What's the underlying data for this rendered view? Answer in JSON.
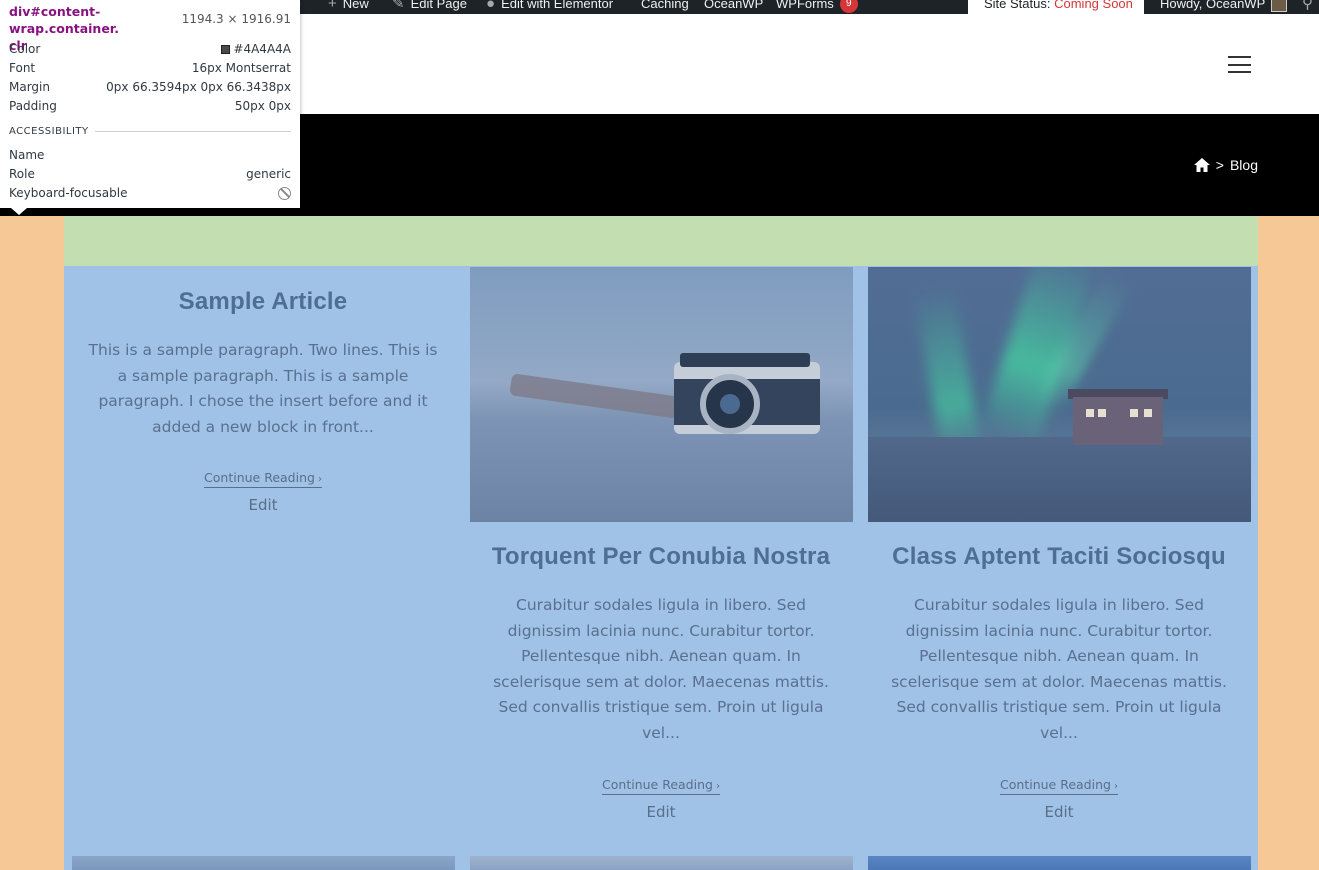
{
  "adminbar": {
    "items": [
      {
        "label": "New",
        "icon": "plus-icon"
      },
      {
        "label": "Edit Page",
        "icon": "pencil-icon"
      },
      {
        "label": "Edit with Elementor",
        "icon": "elementor-icon"
      },
      {
        "label": "Caching"
      },
      {
        "label": "OceanWP"
      },
      {
        "label": "WPForms",
        "badge": "9"
      }
    ],
    "site_status_label": "Site Status:",
    "site_status_value": "Coming Soon",
    "howdy": "Howdy, OceanWP"
  },
  "breadcrumb": {
    "separator": ">",
    "current": "Blog"
  },
  "tooltip": {
    "selector": "div#content-wrap.container.",
    "selector_cont": "clr",
    "dimensions": "1194.3 × 1916.91",
    "color_label": "Color",
    "color_value": "#4A4A4A",
    "font_label": "Font",
    "font_value": "16px Montserrat",
    "margin_label": "Margin",
    "margin_value": "0px 66.3594px 0px 66.3438px",
    "padding_label": "Padding",
    "padding_value": "50px 0px",
    "section": "ACCESSIBILITY",
    "name_label": "Name",
    "name_value": "",
    "role_label": "Role",
    "role_value": "generic",
    "focus_label": "Keyboard-focusable"
  },
  "articles": [
    {
      "title": "Sample Article",
      "excerpt": "This is a sample paragraph. Two lines. This is a sample paragraph. This is a sample paragraph. I chose the insert before and it added a new block in front...",
      "read_more": "Continue Reading",
      "edit": "Edit"
    },
    {
      "title": "Torquent Per Conubia Nostra",
      "excerpt": "Curabitur sodales ligula in libero. Sed dignissim lacinia nunc. Curabitur tortor. Pellentesque nibh. Aenean quam. In scelerisque sem at dolor. Maecenas mattis. Sed convallis tristique sem. Proin ut ligula vel...",
      "read_more": "Continue Reading",
      "edit": "Edit"
    },
    {
      "title": "Class Aptent Taciti Sociosqu",
      "excerpt": "Curabitur sodales ligula in libero. Sed dignissim lacinia nunc. Curabitur tortor. Pellentesque nibh. Aenean quam. In scelerisque sem at dolor. Maecenas mattis. Sed convallis tristique sem. Proin ut ligula vel...",
      "read_more": "Continue Reading",
      "edit": "Edit"
    }
  ],
  "colors": {
    "margin_overlay": "#f6c896",
    "padding_overlay": "#c3dfb2",
    "content_overlay": "#9fc2e6",
    "admin_bar": "#1d2327",
    "coming_soon": "#d63638"
  }
}
